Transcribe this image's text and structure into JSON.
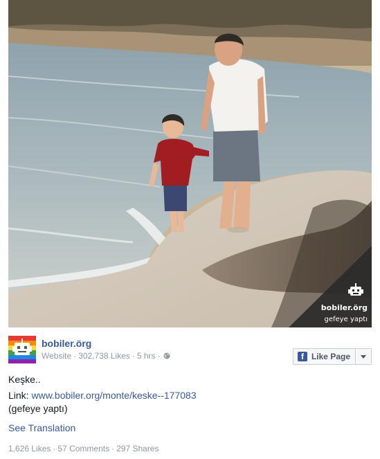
{
  "watermark": {
    "name": "bobiler.örg",
    "credit": "gefeye yaptı"
  },
  "post": {
    "page_name": "bobiler.örg",
    "category": "Website",
    "likes": "302,738 Likes",
    "time": "5 hrs",
    "separator": "·",
    "like_button_label": "Like Page",
    "message": "Keşke..",
    "link_prefix": "Link: ",
    "link_url": "www.bobiler.org/monte/keske--177083",
    "credit_line": "(gefeye yaptı)",
    "see_translation": "See Translation",
    "stats": {
      "likes": "1,626 Likes",
      "comments": "57 Comments",
      "shares": "297 Shares"
    }
  },
  "icons": {
    "globe": "globe-icon",
    "facebook": "facebook-f-icon",
    "caret": "chevron-down-icon",
    "robot": "robot-logo"
  },
  "colors": {
    "link_blue": "#3b5998",
    "meta_gray": "#9197a3",
    "text": "#141823",
    "watermark_bg": "#2b2b2b"
  }
}
